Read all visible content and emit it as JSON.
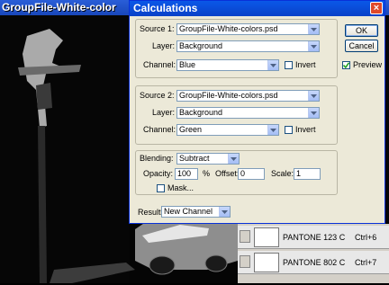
{
  "background_window": {
    "title": "GroupFile-White-color"
  },
  "dialog": {
    "title": "Calculations",
    "close_label": "×",
    "source1": {
      "legend": "Source 1:",
      "file": "GroupFile-White-colors.psd",
      "layer_label": "Layer:",
      "layer_value": "Background",
      "channel_label": "Channel:",
      "channel_value": "Blue",
      "invert_label": "Invert",
      "invert_checked": false
    },
    "source2": {
      "legend": "Source 2:",
      "file": "GroupFile-White-colors.psd",
      "layer_label": "Layer:",
      "layer_value": "Background",
      "channel_label": "Channel:",
      "channel_value": "Green",
      "invert_label": "Invert",
      "invert_checked": false
    },
    "blending": {
      "label": "Blending:",
      "value": "Subtract",
      "opacity_label": "Opacity:",
      "opacity_value": "100",
      "opacity_unit": "%",
      "offset_label": "Offset:",
      "offset_value": "0",
      "scale_label": "Scale:",
      "scale_value": "1",
      "mask_label": "Mask...",
      "mask_checked": false
    },
    "result": {
      "label": "Result:",
      "value": "New Channel"
    },
    "buttons": {
      "ok": "OK",
      "cancel": "Cancel",
      "preview_label": "Preview",
      "preview_checked": true
    }
  },
  "channels_panel": {
    "rows": [
      {
        "name": "PANTONE 123 C",
        "shortcut": "Ctrl+6"
      },
      {
        "name": "PANTONE 802 C",
        "shortcut": "Ctrl+7"
      }
    ]
  },
  "colors": {
    "dialog_bg": "#ece9d8",
    "titlebar_blue": "#0a58e8",
    "field_border": "#7f9db9"
  }
}
